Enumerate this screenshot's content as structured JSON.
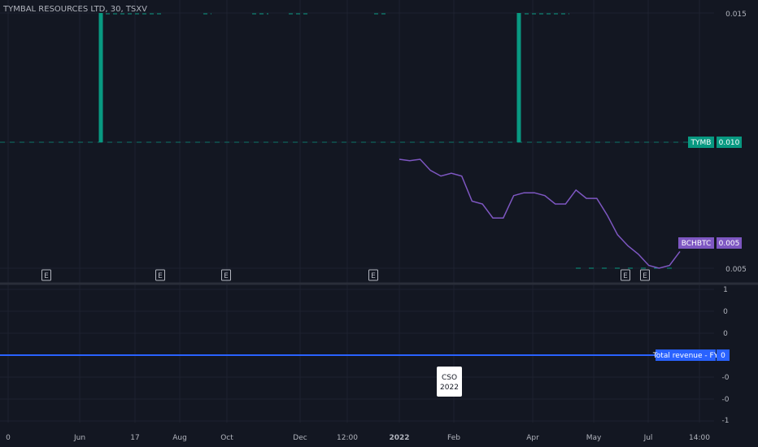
{
  "chart_title": "TYMBAL RESOURCES LTD, 30, TSXV",
  "colors": {
    "background": "#131722",
    "grid": "#1e2230",
    "volume": "#089981",
    "bchbtc": "#7e57c2",
    "revenue": "#2962ff",
    "tymb_tag": "#089981"
  },
  "chart_data": [
    {
      "type": "bar",
      "panel": "top",
      "y_ticks": [
        "0.015",
        "0.005"
      ],
      "tags": [
        {
          "symbol": "TYMB",
          "value": "0.010",
          "y": 0.01,
          "color": "#089981"
        },
        {
          "symbol": "BCHBTC",
          "value": "0.005",
          "y": 0.0058,
          "color": "#7e57c2"
        }
      ],
      "volume_spikes": [
        {
          "x": "Jun",
          "value": 0.015
        },
        {
          "x": "Apr",
          "value": 0.015
        }
      ],
      "baseline": 0.01,
      "series": [
        {
          "name": "BCHBTC",
          "type": "line",
          "values": [
            0.0089,
            0.00885,
            0.0089,
            0.0085,
            0.0083,
            0.0084,
            0.0083,
            0.0074,
            0.0073,
            0.0068,
            0.0068,
            0.0076,
            0.0077,
            0.0077,
            0.0076,
            0.0073,
            0.0073,
            0.0078,
            0.0075,
            0.0075,
            0.0069,
            0.0062,
            0.0058,
            0.0055,
            0.0051,
            0.005,
            0.0051,
            0.0056
          ]
        }
      ],
      "earnings_markers": [
        "E",
        "E",
        "E",
        "E",
        "E",
        "E"
      ]
    },
    {
      "type": "line",
      "panel": "bottom",
      "series_name": "Total revenue - FY",
      "value": "0",
      "y_ticks": [
        "1",
        "0",
        "0",
        "0",
        "-0",
        "-0",
        "-1"
      ],
      "event_label_line1": "CSO",
      "event_label_line2": "2022"
    }
  ],
  "x_ticks": [
    "0",
    "Jun",
    "17",
    "Aug",
    "Oct",
    "Dec",
    "12:00",
    "2022",
    "Feb",
    "Apr",
    "May",
    "Jul",
    "14:00"
  ]
}
